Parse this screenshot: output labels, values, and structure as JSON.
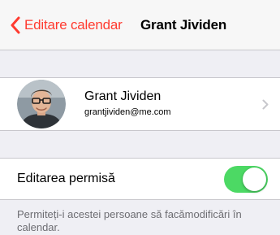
{
  "navbar": {
    "back_label": "Editare calendar",
    "title": "Grant Jividen"
  },
  "contact": {
    "name": "Grant Jividen",
    "email": "grantjividen@me.com"
  },
  "editing": {
    "label": "Editarea permisă",
    "enabled": true
  },
  "footer": {
    "note": "Permiteți-i acestei persoane să facămodificări în calendar."
  },
  "colors": {
    "accent": "#ff3b30",
    "toggle_on": "#4cd964",
    "background": "#efeff4"
  },
  "icons": {
    "back": "chevron-left-icon",
    "disclosure": "chevron-right-icon"
  }
}
